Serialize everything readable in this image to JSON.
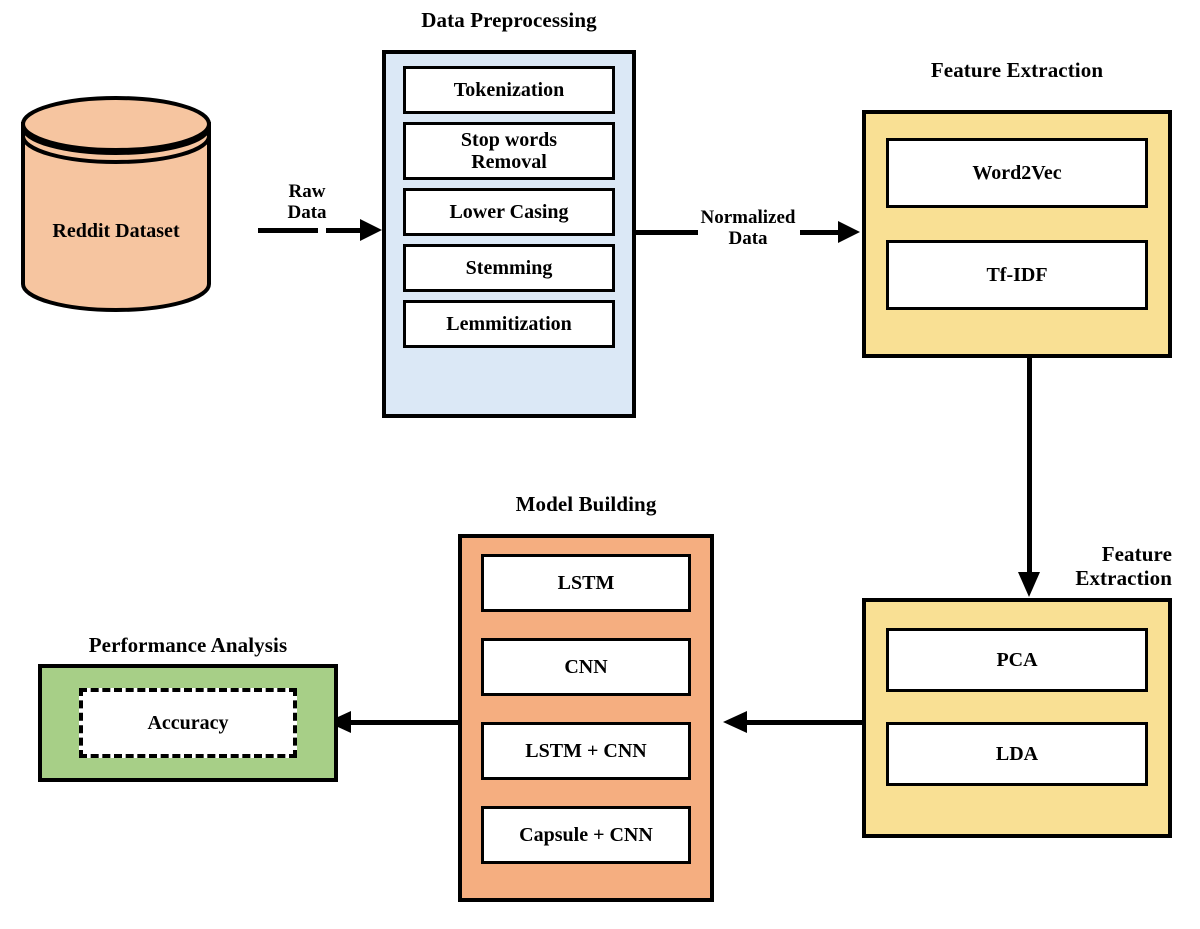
{
  "diagram": {
    "title": "Reddit sentiment analysis pipeline flowchart",
    "background": "#ffffff",
    "colors": {
      "preprocessing_fill": "#dbe8f6",
      "feature_fill": "#f9e094",
      "model_fill": "#f5ae80",
      "performance_fill": "#a7cf87",
      "dataset_fill": "#f6c5a0",
      "stroke": "#000000",
      "item_fill": "#ffffff"
    }
  },
  "dataset": {
    "label": "Reddit Dataset",
    "shape": "cylinder"
  },
  "preprocessing": {
    "title": "Data Preprocessing",
    "items": [
      {
        "label": "Tokenization"
      },
      {
        "label": "Stop words\nRemoval"
      },
      {
        "label": "Lower Casing"
      },
      {
        "label": "Stemming"
      },
      {
        "label": "Lemmitization"
      }
    ]
  },
  "feature_extraction_top": {
    "title": "Feature Extraction",
    "items": [
      {
        "label": "Word2Vec"
      },
      {
        "label": "Tf-IDF"
      }
    ]
  },
  "feature_extraction_bottom": {
    "title": "Feature\nExtraction",
    "items": [
      {
        "label": "PCA"
      },
      {
        "label": "LDA"
      }
    ]
  },
  "model_building": {
    "title": "Model Building",
    "items": [
      {
        "label": "LSTM"
      },
      {
        "label": "CNN"
      },
      {
        "label": "LSTM + CNN"
      },
      {
        "label": "Capsule + CNN"
      }
    ]
  },
  "performance_analysis": {
    "title": "Performance Analysis",
    "items": [
      {
        "label": "Accuracy",
        "border": "dashed"
      }
    ]
  },
  "connectors": [
    {
      "id": "dataset-to-preprocessing",
      "label": "Raw\nData",
      "direction": "right"
    },
    {
      "id": "preprocessing-to-feature-top",
      "label": "Normalized\nData",
      "direction": "right"
    },
    {
      "id": "feature-top-to-feature-bottom",
      "label": "",
      "direction": "down"
    },
    {
      "id": "feature-bottom-to-model",
      "label": "",
      "direction": "left"
    },
    {
      "id": "model-to-performance",
      "label": "",
      "direction": "left"
    }
  ]
}
